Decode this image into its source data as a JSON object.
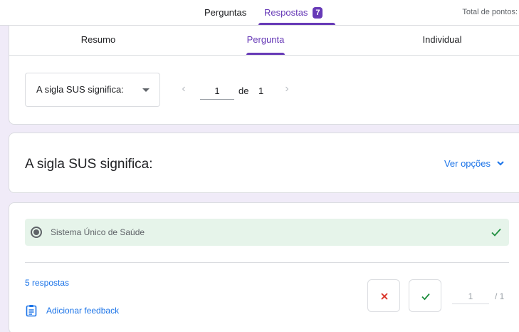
{
  "top_tabs": {
    "questions_label": "Perguntas",
    "responses_label": "Respostas",
    "responses_count": "7",
    "total_points_label": "Total de pontos:"
  },
  "sub_tabs": {
    "summary_label": "Resumo",
    "question_label": "Pergunta",
    "individual_label": "Individual",
    "active": "Pergunta"
  },
  "selector": {
    "selected_question": "A sigla SUS significa:",
    "current_page": "1",
    "of_label": "de",
    "total_pages": "1"
  },
  "question": {
    "title": "A sigla SUS significa:",
    "see_options_label": "Ver opções"
  },
  "answer": {
    "option_label": "Sistema Único de Saúde",
    "responses_link": "5 respostas",
    "feedback_label": "Adicionar feedback",
    "score_value": "1",
    "score_total": "/ 1"
  },
  "colors": {
    "accent": "#673ab7",
    "link": "#1a73e8",
    "correct_bg": "#e6f4ea",
    "correct": "#1e8e3e",
    "incorrect": "#d93025",
    "page_bg": "#f0ebf8"
  }
}
